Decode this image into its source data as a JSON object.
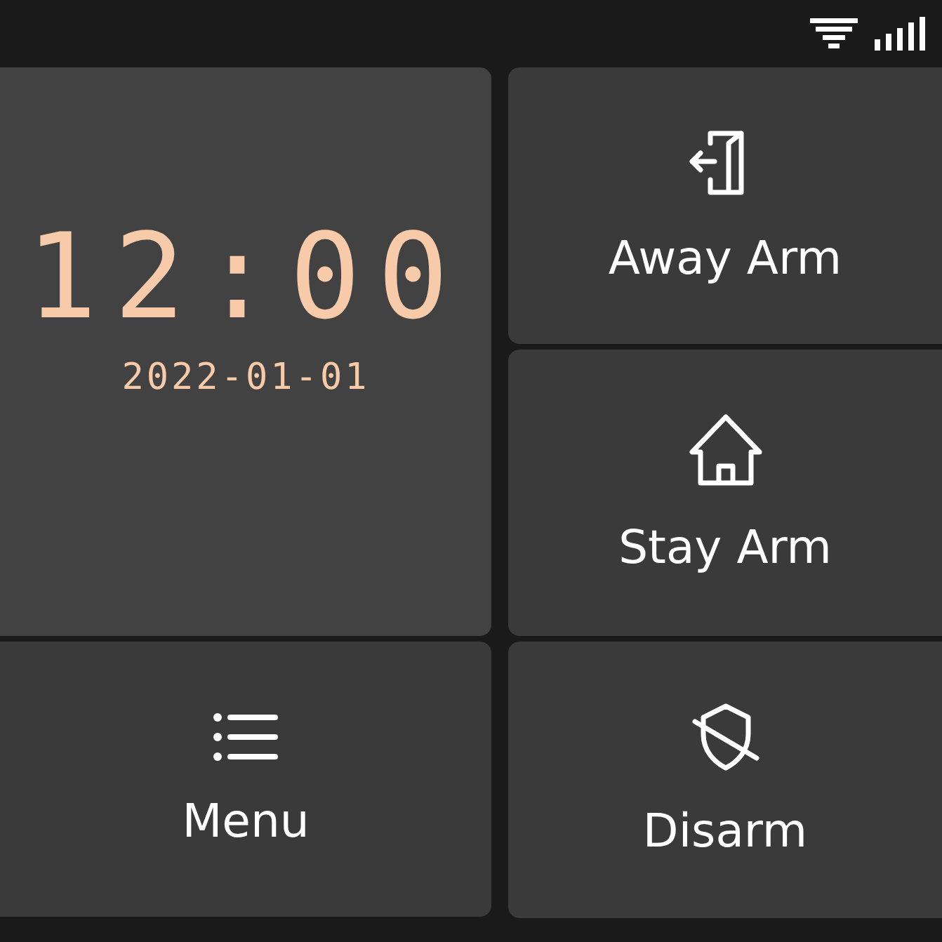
{
  "clock": {
    "time": "12:00",
    "date": "2022-01-01"
  },
  "menu": {
    "label": "Menu"
  },
  "actions": [
    {
      "kind": "away",
      "label": "Away Arm"
    },
    {
      "kind": "stay",
      "label": "Stay Arm"
    },
    {
      "kind": "disarm",
      "label": "Disarm"
    }
  ]
}
